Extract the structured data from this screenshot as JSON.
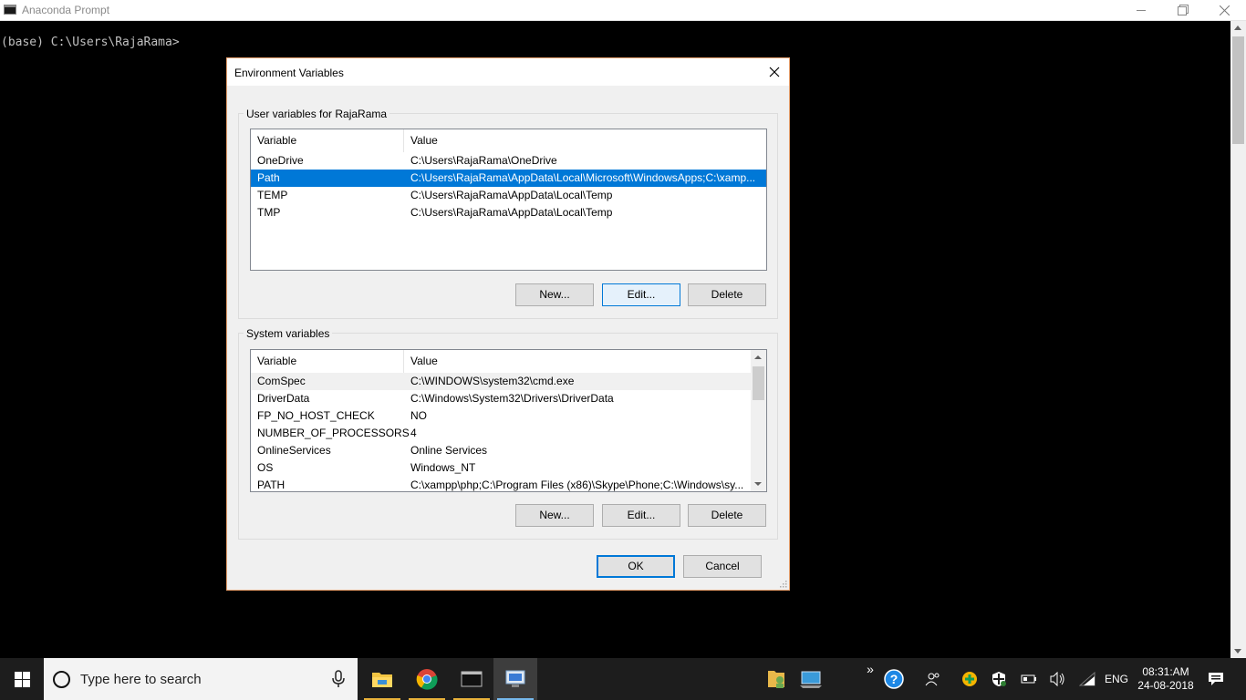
{
  "console": {
    "title": "Anaconda Prompt",
    "prompt": "(base) C:\\Users\\RajaRama>"
  },
  "dialog": {
    "title": "Environment Variables",
    "user_group_label": "User variables for RajaRama",
    "system_group_label": "System variables",
    "columns": [
      "Variable",
      "Value"
    ],
    "user_vars": [
      {
        "name": "OneDrive",
        "value": "C:\\Users\\RajaRama\\OneDrive"
      },
      {
        "name": "Path",
        "value": "C:\\Users\\RajaRama\\AppData\\Local\\Microsoft\\WindowsApps;C:\\xamp..."
      },
      {
        "name": "TEMP",
        "value": "C:\\Users\\RajaRama\\AppData\\Local\\Temp"
      },
      {
        "name": "TMP",
        "value": "C:\\Users\\RajaRama\\AppData\\Local\\Temp"
      }
    ],
    "user_selected_index": 1,
    "system_vars": [
      {
        "name": "ComSpec",
        "value": "C:\\WINDOWS\\system32\\cmd.exe"
      },
      {
        "name": "DriverData",
        "value": "C:\\Windows\\System32\\Drivers\\DriverData"
      },
      {
        "name": "FP_NO_HOST_CHECK",
        "value": "NO"
      },
      {
        "name": "NUMBER_OF_PROCESSORS",
        "value": "4"
      },
      {
        "name": "OnlineServices",
        "value": "Online Services"
      },
      {
        "name": "OS",
        "value": "Windows_NT"
      },
      {
        "name": "PATH",
        "value": "C:\\xampp\\php;C:\\Program Files (x86)\\Skype\\Phone;C:\\Windows\\sy..."
      }
    ],
    "buttons": {
      "new": "New...",
      "edit": "Edit...",
      "delete": "Delete",
      "ok": "OK",
      "cancel": "Cancel"
    }
  },
  "taskbar": {
    "search_placeholder": "Type here to search",
    "apps": [
      "file-explorer",
      "chrome",
      "command-prompt",
      "environment-variables"
    ],
    "language": "ENG",
    "time": "08:31:AM",
    "date": "24-08-2018"
  },
  "colors": {
    "selection": "#0078d7",
    "dialog_border": "#e8a06c",
    "taskbar": "#1d1d1d"
  }
}
